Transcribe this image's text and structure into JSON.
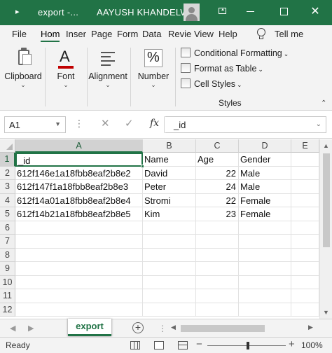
{
  "titlebar": {
    "doc_title": "export  -...",
    "user_name": "AAYUSH KHANDELWAL",
    "close_glyph": "✕"
  },
  "ribbon_tabs": [
    "File",
    "Hom",
    "Inser",
    "Page",
    "Form",
    "Data",
    "Revie",
    "View",
    "Help"
  ],
  "active_tab": "Hom",
  "tell_me": "Tell me",
  "groups": {
    "clipboard": "Clipboard",
    "font": "Font",
    "font_glyph": "A",
    "alignment": "Alignment",
    "number": "Number",
    "number_glyph": "%",
    "styles": {
      "conditional_formatting": "Conditional Formatting",
      "format_as_table": "Format as Table",
      "cell_styles": "Cell Styles",
      "label": "Styles"
    }
  },
  "formula_bar": {
    "name_box": "A1",
    "fx": "fx",
    "content": "_id"
  },
  "columns": [
    "A",
    "B",
    "C",
    "D",
    "E"
  ],
  "rows": [
    "1",
    "2",
    "3",
    "4",
    "5",
    "6",
    "7",
    "8",
    "9",
    "10",
    "11",
    "12"
  ],
  "cells": [
    [
      "_id",
      "Name",
      "Age",
      "Gender"
    ],
    [
      "612f146e1a18fbb8eaf2b8e2",
      "David",
      "22",
      "Male"
    ],
    [
      "612f147f1a18fbb8eaf2b8e3",
      "Peter",
      "24",
      "Male"
    ],
    [
      "612f14a01a18fbb8eaf2b8e4",
      "Stromi",
      "22",
      "Female"
    ],
    [
      "612f14b21a18fbb8eaf2b8e5",
      "Kim",
      "23",
      "Female"
    ]
  ],
  "sheet_tab": "export",
  "status": "Ready",
  "zoom": "100%",
  "colors": {
    "accent": "#217346"
  }
}
